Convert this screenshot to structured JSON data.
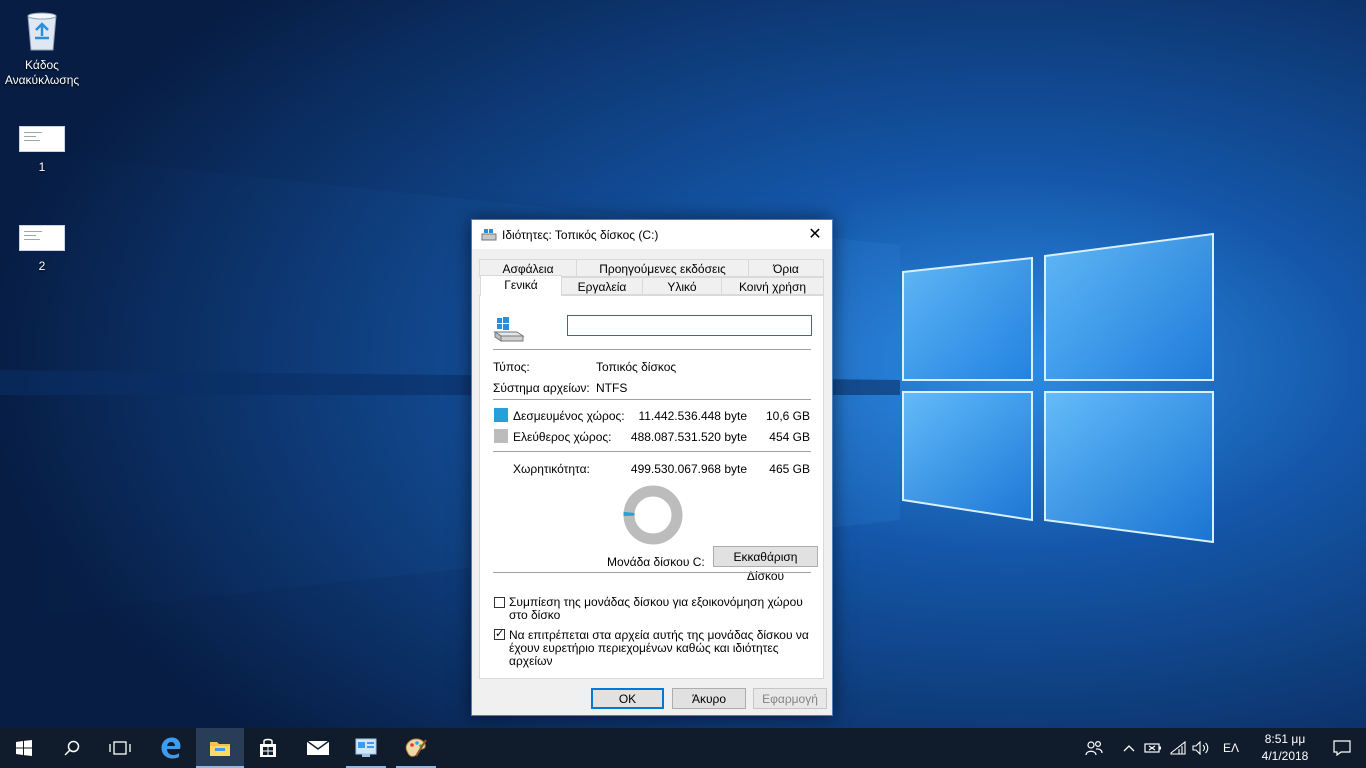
{
  "desktop": {
    "icons": [
      {
        "label_line1": "Κάδος",
        "label_line2": "Ανακύκλωσης"
      },
      {
        "label": "1"
      },
      {
        "label": "2"
      }
    ]
  },
  "dialog": {
    "title": "Ιδιότητες: Τοπικός δίσκος (C:)",
    "tabs_back": [
      "Ασφάλεια",
      "Προηγούμενες εκδόσεις",
      "Όρια"
    ],
    "tabs_front": [
      "Γενικά",
      "Εργαλεία",
      "Υλικό",
      "Κοινή χρήση"
    ],
    "active_tab": "Γενικά",
    "name_value": "",
    "type_label": "Τύπος:",
    "type_value": "Τοπικός δίσκος",
    "fs_label": "Σύστημα αρχείων:",
    "fs_value": "NTFS",
    "used_label": "Δεσμευμένος χώρος:",
    "used_bytes": "11.442.536.448 byte",
    "used_gb": "10,6 GB",
    "free_label": "Ελεύθερος χώρος:",
    "free_bytes": "488.087.531.520 byte",
    "free_gb": "454 GB",
    "cap_label": "Χωρητικότητα:",
    "cap_bytes": "499.530.067.968 byte",
    "cap_gb": "465 GB",
    "used_fraction": 0.0229,
    "drive_label": "Μονάδα δίσκου C:",
    "cleanup_button": "Εκκαθάριση Δίσκου",
    "compress_text_1": "Συμπίεση της μονάδας δίσκου για εξοικονόμηση χώρου",
    "compress_text_2": "στο δίσκο",
    "compress_checked": false,
    "index_text_1": "Να επιτρέπεται στα αρχεία αυτής της μονάδας δίσκου να",
    "index_text_2": "έχουν ευρετήριο περιεχομένων καθώς και ιδιότητες",
    "index_text_3": "αρχείων",
    "index_checked": true,
    "ok_button": "OK",
    "cancel_button": "Άκυρο",
    "apply_button": "Εφαρμογή",
    "colors": {
      "used": "#26a0da",
      "free": "#bcbcbc"
    }
  },
  "taskbar": {
    "language": "ΕΛ",
    "time": "8:51 μμ",
    "date": "4/1/2018",
    "pinned": [
      "start-icon",
      "search-icon",
      "task-view-icon",
      "edge-icon",
      "file-explorer-icon",
      "store-icon",
      "mail-icon",
      "control-panel-icon",
      "paint-icon"
    ],
    "tray_icons": [
      "people-icon",
      "chevron-up-icon",
      "battery-icon",
      "wifi-icon",
      "volume-icon",
      "notification-icon"
    ]
  }
}
